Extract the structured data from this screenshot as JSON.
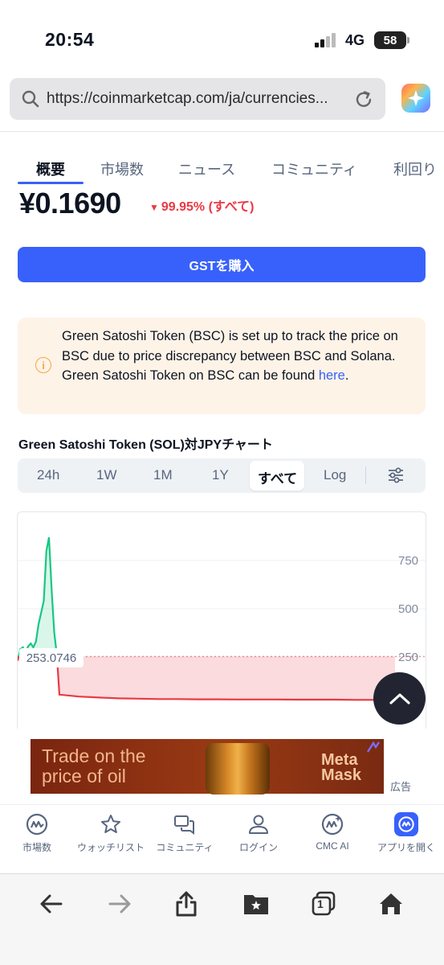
{
  "status_bar": {
    "time": "20:54",
    "network": "4G",
    "battery": "58"
  },
  "browser": {
    "url": "https://coinmarketcap.com/ja/currencies..."
  },
  "tabs": [
    {
      "label": "概要",
      "active": true
    },
    {
      "label": "市場数"
    },
    {
      "label": "ニュース"
    },
    {
      "label": "コミュニティ"
    },
    {
      "label": "利回り"
    }
  ],
  "price": {
    "value": "¥0.1690",
    "change": "99.95% (すべて)",
    "direction": "down",
    "change_color": "#ea3943"
  },
  "buy_button": {
    "label": "GSTを購入",
    "color": "#3861fb"
  },
  "notice": {
    "text": "Green Satoshi Token (BSC) is set up to track the price on BSC due to price discrepancy between BSC and Solana. Green Satoshi Token on BSC can be found ",
    "link": "here",
    "end": "."
  },
  "chart": {
    "title": "Green Satoshi Token (SOL)対JPYチャート",
    "ranges": [
      "24h",
      "1W",
      "1M",
      "1Y",
      "すべて",
      "Log"
    ],
    "active_range": "すべて",
    "current_price_label": "253.0746"
  },
  "chart_data": {
    "type": "area",
    "y_ticks": [
      "750",
      "500",
      "250"
    ],
    "ylim": [
      0,
      1000
    ],
    "x": [
      0,
      1,
      2,
      3,
      4,
      5,
      6,
      7,
      8,
      9,
      10,
      11,
      12,
      13,
      14,
      15,
      16,
      17,
      18,
      19,
      20,
      21,
      22,
      23,
      24,
      25,
      26,
      27,
      28,
      29,
      30,
      31,
      32,
      33
    ],
    "values": [
      230,
      290,
      300,
      270,
      305,
      320,
      300,
      330,
      420,
      480,
      540,
      800,
      870,
      600,
      380,
      260,
      55,
      45,
      40,
      36,
      34,
      32,
      32,
      31,
      31,
      30,
      30,
      30,
      29,
      29,
      29,
      28,
      28,
      28
    ],
    "reference_value": 253.0746,
    "colors": {
      "up": "#16c784",
      "down": "#ea3943"
    }
  },
  "ad": {
    "line1": "Trade on the",
    "line2": "price of oil",
    "brand1": "Meta",
    "brand2": "Mask",
    "label": "広告"
  },
  "bottom_nav": [
    {
      "label": "市場数",
      "icon": "cmc-logo-icon"
    },
    {
      "label": "ウォッチリスト",
      "icon": "star-icon"
    },
    {
      "label": "コミュニティ",
      "icon": "chat-icon"
    },
    {
      "label": "ログイン",
      "icon": "user-icon"
    },
    {
      "label": "CMC AI",
      "icon": "cmc-ai-icon"
    },
    {
      "label": "アプリを開く",
      "icon": "cmc-app-icon"
    }
  ],
  "toolbar": {
    "tabs_count": "1"
  }
}
